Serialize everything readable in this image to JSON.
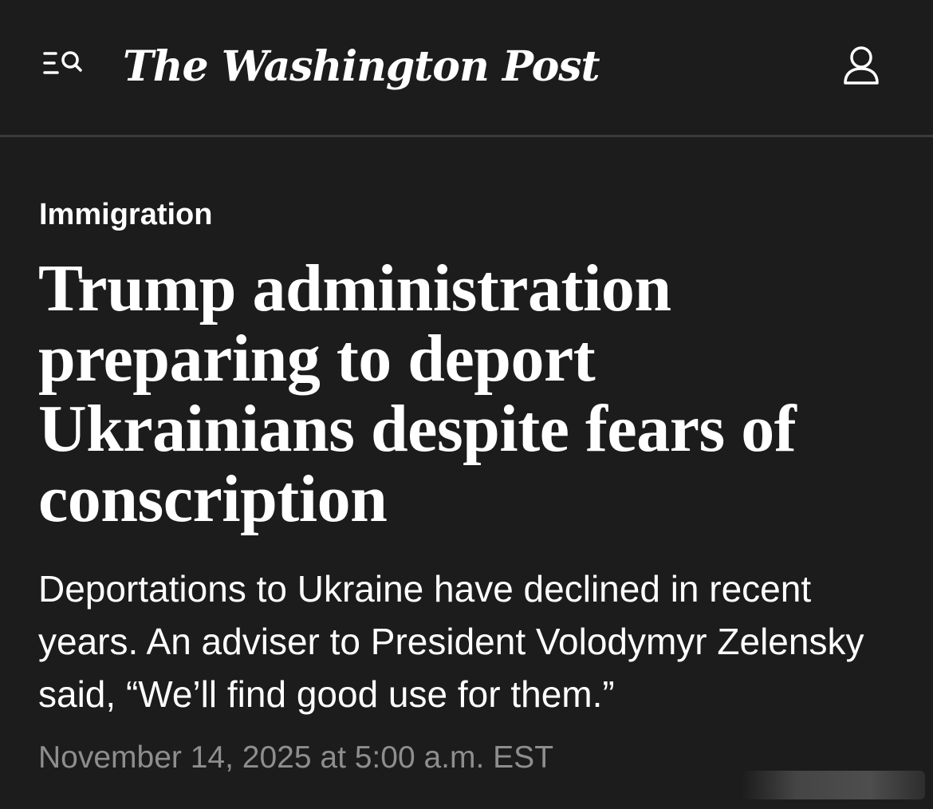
{
  "header": {
    "logo_text": "The Washington Post",
    "menu_icon": "menu-search-icon",
    "account_icon": "user-icon"
  },
  "article": {
    "section": "Immigration",
    "headline": "Trump administration preparing to deport Ukrainians despite fears of conscription",
    "dek": "Deportations to Ukraine have declined in recent years. An adviser to President Volodymyr Zelensky said, “We’ll find good use for them.”",
    "timestamp": "November 14, 2025 at 5:00 a.m. EST"
  },
  "colors": {
    "background": "#1c1c1c",
    "text": "#ffffff",
    "timestamp": "#8e8e8e",
    "divider": "#3a3a3a"
  }
}
